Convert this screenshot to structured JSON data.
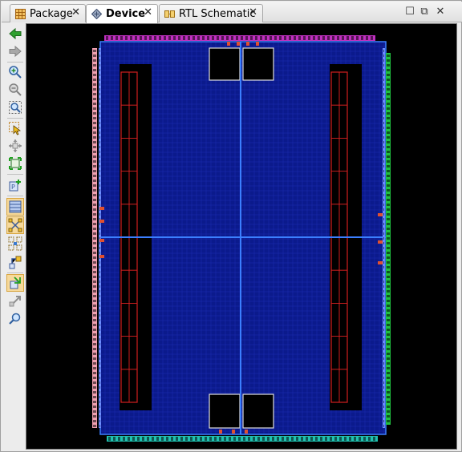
{
  "tabs": [
    {
      "label": "Package",
      "icon": "package-icon",
      "active": false
    },
    {
      "label": "Device",
      "icon": "device-icon",
      "active": true
    },
    {
      "label": "RTL Schematic",
      "icon": "rtl-schematic-icon",
      "active": false
    }
  ],
  "tab_close_glyph": "✕",
  "window_controls": {
    "restore_glyph": "☐",
    "maximize_glyph": "⧉",
    "close_glyph": "✕"
  },
  "toolbar": [
    {
      "name": "back-arrow-icon",
      "toggled": false
    },
    {
      "name": "forward-arrow-icon",
      "toggled": false
    },
    {
      "name": "zoom-in-icon",
      "toggled": false
    },
    {
      "name": "zoom-out-icon",
      "toggled": false
    },
    {
      "name": "zoom-fit-icon",
      "toggled": false
    },
    {
      "name": "select-area-icon",
      "toggled": false
    },
    {
      "name": "zoom-to-selection-icon",
      "toggled": false
    },
    {
      "name": "autofit-selection-icon",
      "toggled": false
    },
    {
      "name": "create-pblock-icon",
      "toggled": false
    },
    {
      "name": "show-io-bank-icon",
      "toggled": true
    },
    {
      "name": "routing-resources-icon",
      "toggled": true
    },
    {
      "name": "show-clock-regions-icon",
      "toggled": false
    },
    {
      "name": "show-nets-icon",
      "toggled": false
    },
    {
      "name": "show-cell-connections-icon",
      "toggled": true
    },
    {
      "name": "unplace-icon",
      "toggled": false
    },
    {
      "name": "search-pin-icon",
      "toggled": false
    }
  ],
  "colors": {
    "fabric": "#0b1a8c",
    "fabric_grid": "#2a3fd0",
    "clock_line": "#3b7fff",
    "bram_outline": "#d02020",
    "io_left": "#f0a0b0",
    "io_top": "#c030c0",
    "io_right": "#20c040",
    "io_bottom": "#20c0b0",
    "accent_tab": "#f6d99b"
  }
}
